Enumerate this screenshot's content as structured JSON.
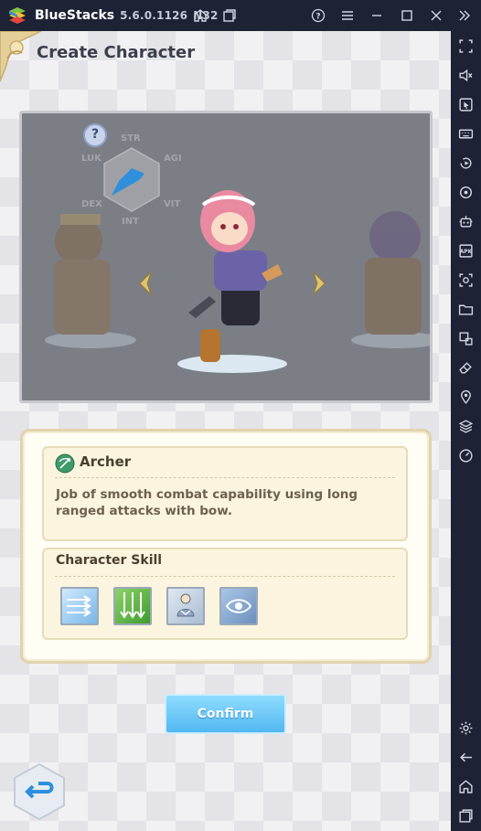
{
  "titlebar": {
    "app_name": "BlueStacks",
    "version": "5.6.0.1126",
    "arch": "N32"
  },
  "game": {
    "page_title": "Create Character",
    "help_badge": "?",
    "stats": [
      "STR",
      "AGI",
      "VIT",
      "INT",
      "DEX",
      "LUK"
    ],
    "class": {
      "name": "Archer",
      "description": "Job of smooth combat capability using long ranged attacks with bow."
    },
    "skills_title": "Character Skill",
    "skills": [
      "multi-arrow-skill-icon",
      "arrow-rain-skill-icon",
      "concentration-skill-icon",
      "eagle-eye-skill-icon"
    ],
    "confirm_label": "Confirm"
  },
  "colors": {
    "titlebar_bg": "#1d2235",
    "confirm_button": "#52b7ef",
    "accent_gold": "#e1d3ad"
  }
}
